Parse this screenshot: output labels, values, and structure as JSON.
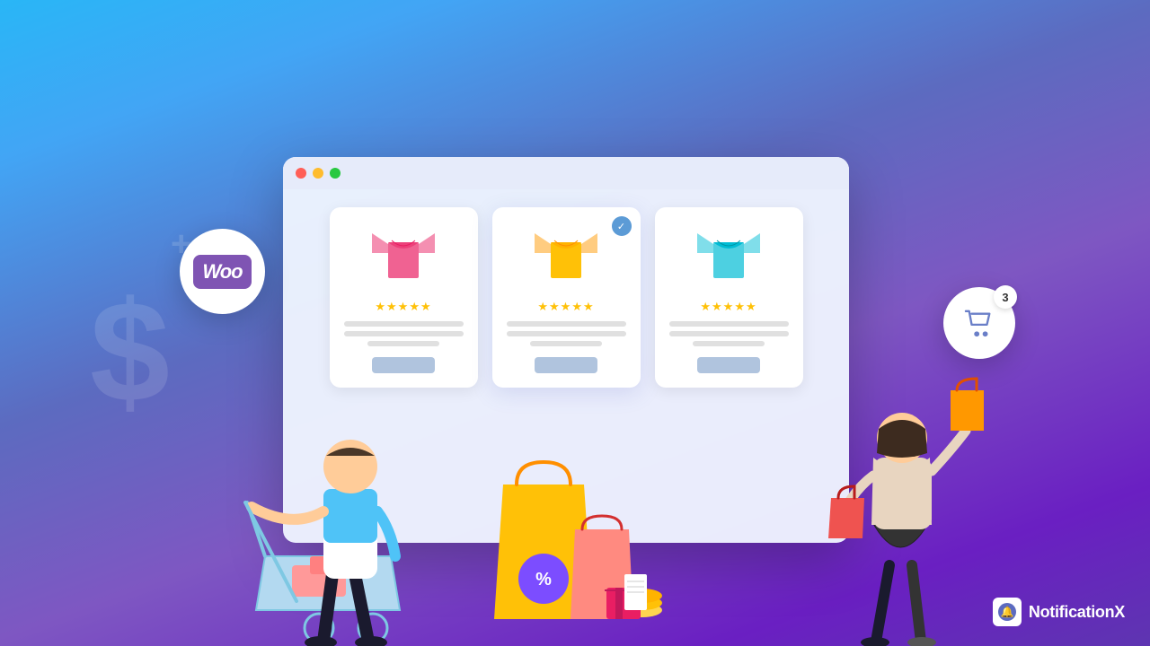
{
  "background": {
    "gradient_start": "#29b6f6",
    "gradient_end": "#5e35b1"
  },
  "woo_badge": {
    "text": "Woo",
    "bg_color": "#7f54b3"
  },
  "cart_badge": {
    "count": "3"
  },
  "browser": {
    "dots": [
      "#ff5f57",
      "#febc2e",
      "#28c840"
    ],
    "products": [
      {
        "id": 1,
        "shirt_color": "#f06292",
        "stars": "★★★★★",
        "featured": false,
        "has_check": false
      },
      {
        "id": 2,
        "shirt_color": "#ffc107",
        "stars": "★★★★★",
        "featured": true,
        "has_check": true
      },
      {
        "id": 3,
        "shirt_color": "#4dd0e1",
        "stars": "★★★★★",
        "featured": false,
        "has_check": false
      }
    ]
  },
  "brand": {
    "name": "NotificationX",
    "icon": "🔔"
  },
  "watermark": {
    "dollar": "$",
    "plus": "+"
  }
}
